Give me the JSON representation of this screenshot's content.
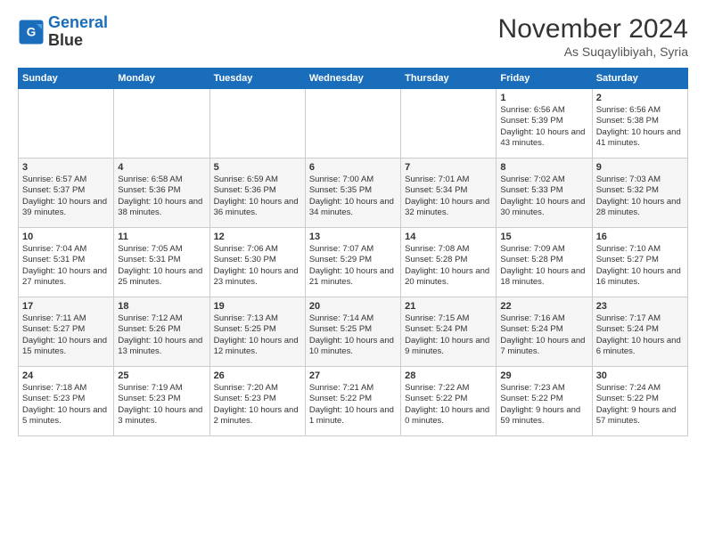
{
  "header": {
    "logo_line1": "General",
    "logo_line2": "Blue",
    "month": "November 2024",
    "location": "As Suqaylibiyah, Syria"
  },
  "days_of_week": [
    "Sunday",
    "Monday",
    "Tuesday",
    "Wednesday",
    "Thursday",
    "Friday",
    "Saturday"
  ],
  "weeks": [
    [
      {
        "day": "",
        "info": ""
      },
      {
        "day": "",
        "info": ""
      },
      {
        "day": "",
        "info": ""
      },
      {
        "day": "",
        "info": ""
      },
      {
        "day": "",
        "info": ""
      },
      {
        "day": "1",
        "info": "Sunrise: 6:56 AM\nSunset: 5:39 PM\nDaylight: 10 hours and 43 minutes."
      },
      {
        "day": "2",
        "info": "Sunrise: 6:56 AM\nSunset: 5:38 PM\nDaylight: 10 hours and 41 minutes."
      }
    ],
    [
      {
        "day": "3",
        "info": "Sunrise: 6:57 AM\nSunset: 5:37 PM\nDaylight: 10 hours and 39 minutes."
      },
      {
        "day": "4",
        "info": "Sunrise: 6:58 AM\nSunset: 5:36 PM\nDaylight: 10 hours and 38 minutes."
      },
      {
        "day": "5",
        "info": "Sunrise: 6:59 AM\nSunset: 5:36 PM\nDaylight: 10 hours and 36 minutes."
      },
      {
        "day": "6",
        "info": "Sunrise: 7:00 AM\nSunset: 5:35 PM\nDaylight: 10 hours and 34 minutes."
      },
      {
        "day": "7",
        "info": "Sunrise: 7:01 AM\nSunset: 5:34 PM\nDaylight: 10 hours and 32 minutes."
      },
      {
        "day": "8",
        "info": "Sunrise: 7:02 AM\nSunset: 5:33 PM\nDaylight: 10 hours and 30 minutes."
      },
      {
        "day": "9",
        "info": "Sunrise: 7:03 AM\nSunset: 5:32 PM\nDaylight: 10 hours and 28 minutes."
      }
    ],
    [
      {
        "day": "10",
        "info": "Sunrise: 7:04 AM\nSunset: 5:31 PM\nDaylight: 10 hours and 27 minutes."
      },
      {
        "day": "11",
        "info": "Sunrise: 7:05 AM\nSunset: 5:31 PM\nDaylight: 10 hours and 25 minutes."
      },
      {
        "day": "12",
        "info": "Sunrise: 7:06 AM\nSunset: 5:30 PM\nDaylight: 10 hours and 23 minutes."
      },
      {
        "day": "13",
        "info": "Sunrise: 7:07 AM\nSunset: 5:29 PM\nDaylight: 10 hours and 21 minutes."
      },
      {
        "day": "14",
        "info": "Sunrise: 7:08 AM\nSunset: 5:28 PM\nDaylight: 10 hours and 20 minutes."
      },
      {
        "day": "15",
        "info": "Sunrise: 7:09 AM\nSunset: 5:28 PM\nDaylight: 10 hours and 18 minutes."
      },
      {
        "day": "16",
        "info": "Sunrise: 7:10 AM\nSunset: 5:27 PM\nDaylight: 10 hours and 16 minutes."
      }
    ],
    [
      {
        "day": "17",
        "info": "Sunrise: 7:11 AM\nSunset: 5:27 PM\nDaylight: 10 hours and 15 minutes."
      },
      {
        "day": "18",
        "info": "Sunrise: 7:12 AM\nSunset: 5:26 PM\nDaylight: 10 hours and 13 minutes."
      },
      {
        "day": "19",
        "info": "Sunrise: 7:13 AM\nSunset: 5:25 PM\nDaylight: 10 hours and 12 minutes."
      },
      {
        "day": "20",
        "info": "Sunrise: 7:14 AM\nSunset: 5:25 PM\nDaylight: 10 hours and 10 minutes."
      },
      {
        "day": "21",
        "info": "Sunrise: 7:15 AM\nSunset: 5:24 PM\nDaylight: 10 hours and 9 minutes."
      },
      {
        "day": "22",
        "info": "Sunrise: 7:16 AM\nSunset: 5:24 PM\nDaylight: 10 hours and 7 minutes."
      },
      {
        "day": "23",
        "info": "Sunrise: 7:17 AM\nSunset: 5:24 PM\nDaylight: 10 hours and 6 minutes."
      }
    ],
    [
      {
        "day": "24",
        "info": "Sunrise: 7:18 AM\nSunset: 5:23 PM\nDaylight: 10 hours and 5 minutes."
      },
      {
        "day": "25",
        "info": "Sunrise: 7:19 AM\nSunset: 5:23 PM\nDaylight: 10 hours and 3 minutes."
      },
      {
        "day": "26",
        "info": "Sunrise: 7:20 AM\nSunset: 5:23 PM\nDaylight: 10 hours and 2 minutes."
      },
      {
        "day": "27",
        "info": "Sunrise: 7:21 AM\nSunset: 5:22 PM\nDaylight: 10 hours and 1 minute."
      },
      {
        "day": "28",
        "info": "Sunrise: 7:22 AM\nSunset: 5:22 PM\nDaylight: 10 hours and 0 minutes."
      },
      {
        "day": "29",
        "info": "Sunrise: 7:23 AM\nSunset: 5:22 PM\nDaylight: 9 hours and 59 minutes."
      },
      {
        "day": "30",
        "info": "Sunrise: 7:24 AM\nSunset: 5:22 PM\nDaylight: 9 hours and 57 minutes."
      }
    ]
  ]
}
